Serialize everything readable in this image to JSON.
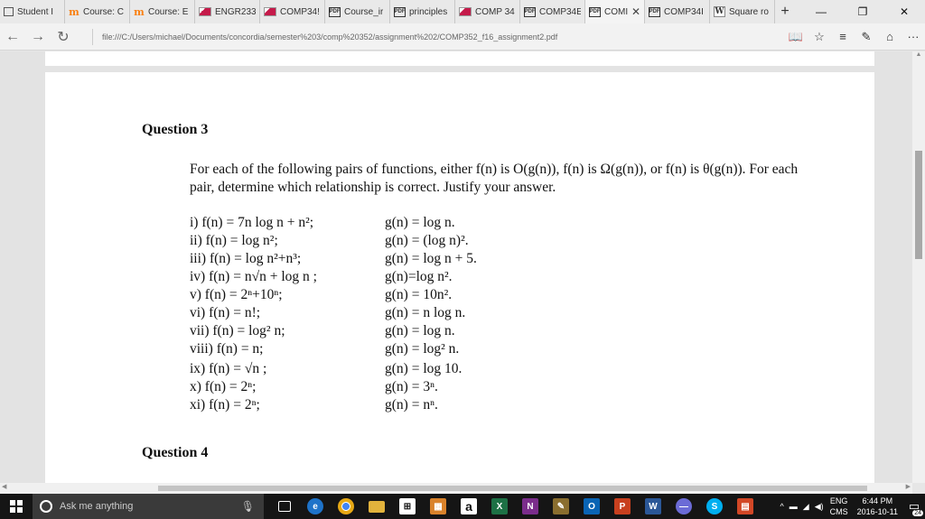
{
  "tabs": [
    {
      "label": "Student I",
      "icon": "square-icon"
    },
    {
      "label": "Course: C",
      "icon": "moodle-icon"
    },
    {
      "label": "Course: E",
      "icon": "moodle-icon"
    },
    {
      "label": "ENGR233",
      "icon": "flag-icon"
    },
    {
      "label": "COMP34!",
      "icon": "flag-icon"
    },
    {
      "label": "Course_ir",
      "icon": "pdf-icon"
    },
    {
      "label": "principles",
      "icon": "pdf-icon"
    },
    {
      "label": "COMP 34",
      "icon": "flag-icon"
    },
    {
      "label": "COMP34E",
      "icon": "pdf-icon"
    },
    {
      "label": "COMI",
      "icon": "pdf-icon",
      "active": true
    },
    {
      "label": "COMP34I",
      "icon": "pdf-icon"
    },
    {
      "label": "Square ro",
      "icon": "wikipedia-icon"
    }
  ],
  "browser": {
    "url": "file:///C:/Users/michael/Documents/concordia/semester%203/comp%20352/assignment%202/COMP352_f16_assignment2.pdf",
    "tab_close": "✕",
    "new_tab": "+"
  },
  "document": {
    "q3_title": "Question 3",
    "q3_text": "For each of the following pairs of functions, either f(n) is O(g(n)), f(n) is Ω(g(n)), or f(n) is θ(g(n)). For each pair, determine which relationship is correct. Justify your answer.",
    "pairs": [
      {
        "f": "i)    f(n) = 7n log n + n²;",
        "g": "g(n) = log n."
      },
      {
        "f": "ii)   f(n) = log n²;",
        "g": "g(n) = (log n)²."
      },
      {
        "f": "iii)  f(n) = log n²+n³;",
        "g": "g(n) = log n + 5."
      },
      {
        "f": "iv)  f(n) = n√n + log n ;",
        "g": "g(n)=log n²."
      },
      {
        "f": "v)    f(n) = 2ⁿ+10ⁿ;",
        "g": "g(n) = 10n²."
      },
      {
        "f": "vi)   f(n) = n!;",
        "g": "g(n) = n log n."
      },
      {
        "f": "vii)  f(n) = log² n;",
        "g": "g(n) = log n."
      },
      {
        "f": "viii) f(n) = n;",
        "g": "g(n) = log² n."
      },
      {
        "f": "ix)   f(n) = √n ;",
        "g": "g(n) = log 10."
      },
      {
        "f": "x)    f(n) = 2ⁿ;",
        "g": "g(n) = 3ⁿ."
      },
      {
        "f": "xi)   f(n) = 2ⁿ;",
        "g": "g(n) = nⁿ."
      }
    ],
    "q4_title": "Question 4"
  },
  "taskbar": {
    "search_placeholder": "Ask me anything",
    "lang_top": "ENG",
    "lang_bottom": "CMS",
    "time": "6:44 PM",
    "date": "2016-10-11",
    "notifications": "24",
    "apps": [
      {
        "name": "task-view",
        "label": "▭",
        "color": "#151515"
      },
      {
        "name": "edge",
        "label": "e",
        "color": "#1e73c9"
      },
      {
        "name": "chrome",
        "label": "◉",
        "color": "#e7a914"
      },
      {
        "name": "file-explorer",
        "label": "▬",
        "color": "#e2b33c"
      },
      {
        "name": "store",
        "label": "⊞",
        "color": "#2c2c2c"
      },
      {
        "name": "app-orange",
        "label": "▦",
        "color": "#d9822b"
      },
      {
        "name": "amazon",
        "label": "a",
        "color": "#ffffff"
      },
      {
        "name": "excel",
        "label": "X",
        "color": "#1d7145"
      },
      {
        "name": "onenote",
        "label": "N",
        "color": "#7b2d8b"
      },
      {
        "name": "app-pen",
        "label": "✎",
        "color": "#8a6e2f"
      },
      {
        "name": "outlook",
        "label": "O",
        "color": "#0a64b4"
      },
      {
        "name": "powerpoint",
        "label": "P",
        "color": "#c8401f"
      },
      {
        "name": "word",
        "label": "W",
        "color": "#2b5797"
      },
      {
        "name": "app-disc",
        "label": "●",
        "color": "#6b6bd6"
      },
      {
        "name": "skype",
        "label": "S",
        "color": "#00aff0"
      },
      {
        "name": "app-red",
        "label": "▤",
        "color": "#d24726"
      }
    ]
  }
}
